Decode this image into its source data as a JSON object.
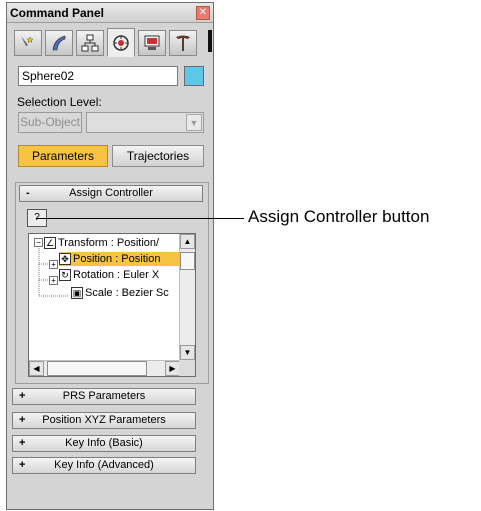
{
  "panel": {
    "title": "Command Panel",
    "close_glyph": "✕",
    "tabs": [
      {
        "name": "create-icon",
        "active": false
      },
      {
        "name": "modify-icon",
        "active": false
      },
      {
        "name": "hierarchy-icon",
        "active": false
      },
      {
        "name": "motion-icon",
        "active": true
      },
      {
        "name": "display-icon",
        "active": false
      },
      {
        "name": "utilities-icon",
        "active": false
      }
    ],
    "object_name": "Sphere02",
    "object_color": "#5cc8e8",
    "selection_level_label": "Selection Level:",
    "subobject_label": "Sub-Object",
    "parameters_label": "Parameters",
    "trajectories_label": "Trajectories",
    "accent_color": "#f6c342"
  },
  "assign_controller": {
    "sign": "-",
    "title": "Assign Controller",
    "button_glyph": "?",
    "tree": [
      {
        "label": "Transform : Position/",
        "icon_glyph": "∠",
        "selected": false
      },
      {
        "label": "Position : Position",
        "icon_glyph": "✥",
        "selected": true
      },
      {
        "label": "Rotation : Euler X",
        "icon_glyph": "↻",
        "selected": false
      },
      {
        "label": "Scale : Bezier Sc",
        "icon_glyph": "▣",
        "selected": false
      }
    ]
  },
  "rollouts": [
    {
      "sign": "+",
      "title": "PRS Parameters"
    },
    {
      "sign": "+",
      "title": "Position XYZ Parameters"
    },
    {
      "sign": "+",
      "title": "Key Info (Basic)"
    },
    {
      "sign": "+",
      "title": "Key Info (Advanced)"
    }
  ],
  "callout": {
    "label": "Assign Controller button"
  }
}
